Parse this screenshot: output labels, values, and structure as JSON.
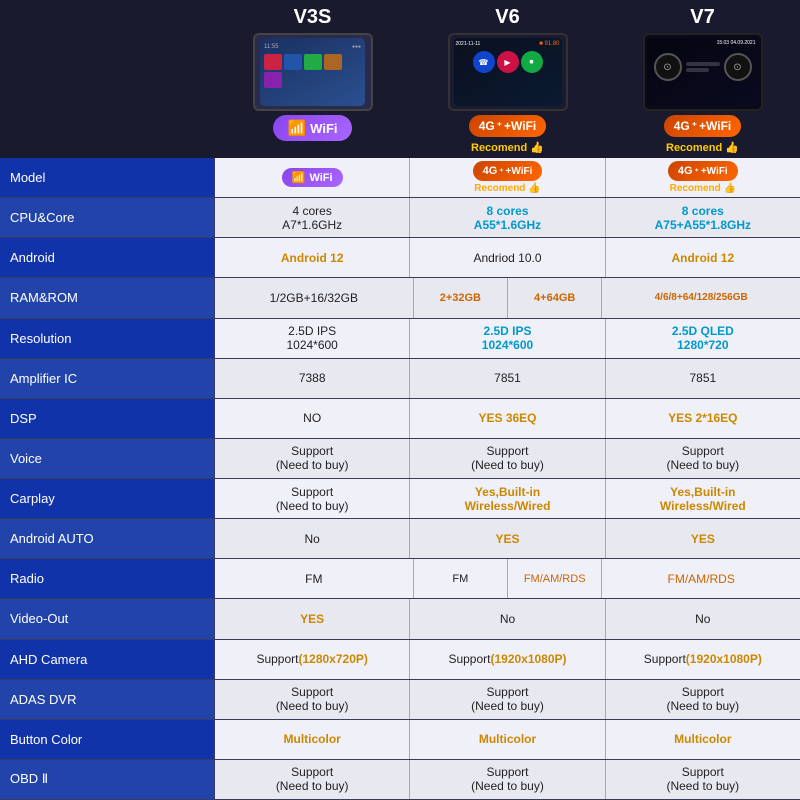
{
  "header": {
    "versions": [
      "V3S",
      "V6",
      "V7"
    ],
    "wifi_badge_v3s": "WiFi",
    "wifi_badge_v6": "4G⁺ + WiFi",
    "wifi_badge_v7": "4G⁺ + WiFi",
    "recommend": "Recomend 👍"
  },
  "rows": [
    {
      "label": "Model",
      "v3s": "WiFi",
      "v6": "4G+ WiFi Recomend",
      "v7": "4G+ WiFi Recomend",
      "type": "model"
    },
    {
      "label": "CPU&Core",
      "v3s": "4 cores\nA7*1.6GHz",
      "v6": "8 cores\nA55*1.6GHz",
      "v7": "8 cores\nA75+A55*1.8GHz",
      "type": "cpu"
    },
    {
      "label": "Android",
      "v3s": "Android 12",
      "v6": "Andriod 10.0",
      "v7": "Android 12",
      "type": "android"
    },
    {
      "label": "RAM&ROM",
      "v3s": "1/2GB+16/32GB",
      "v6_a": "2+32GB",
      "v6_b": "4+64GB",
      "v7": "4/6/8+64/128/256GB",
      "type": "ram"
    },
    {
      "label": "Resolution",
      "v3s": "2.5D IPS\n1024*600",
      "v6": "2.5D IPS\n1024*600",
      "v7": "2.5D QLED\n1280*720",
      "type": "resolution"
    },
    {
      "label": "Amplifier IC",
      "v3s": "7388",
      "v6": "7851",
      "v7": "7851",
      "type": "plain"
    },
    {
      "label": "DSP",
      "v3s": "NO",
      "v6": "YES 36EQ",
      "v7": "YES 2*16EQ",
      "type": "dsp"
    },
    {
      "label": "Voice",
      "v3s": "Support\n(Need to buy)",
      "v6": "Support\n(Need to buy)",
      "v7": "Support\n(Need to buy)",
      "type": "plain"
    },
    {
      "label": "Carplay",
      "v3s": "Support\n(Need to buy)",
      "v6": "Yes,Built-in\nWireless/Wired",
      "v7": "Yes,Built-in\nWireless/Wired",
      "type": "carplay"
    },
    {
      "label": "Android AUTO",
      "v3s": "No",
      "v6": "YES",
      "v7": "YES",
      "type": "androidauto"
    },
    {
      "label": "Radio",
      "v3s": "FM",
      "v6_a": "FM",
      "v6_b": "FM/AM/RDS",
      "v7": "FM/AM/RDS",
      "type": "radio"
    },
    {
      "label": "Video-Out",
      "v3s": "YES",
      "v6": "No",
      "v7": "No",
      "type": "videoout"
    },
    {
      "label": "AHD Camera",
      "v3s": "Support\n(1280x720P)",
      "v6": "Support\n(1920x1080P)",
      "v7": "Support\n(1920x1080P)",
      "type": "ahd"
    },
    {
      "label": "ADAS DVR",
      "v3s": "Support\n(Need to buy)",
      "v6": "Support\n(Need to buy)",
      "v7": "Support\n(Need to buy)",
      "type": "plain"
    },
    {
      "label": "Button Color",
      "v3s": "Multicolor",
      "v6": "Multicolor",
      "v7": "Multicolor",
      "type": "color"
    },
    {
      "label": "OBD Ⅱ",
      "v3s": "Support\n(Need to buy)",
      "v6": "Support\n(Need to buy)",
      "v7": "Support\n(Need to buy)",
      "type": "plain"
    }
  ]
}
